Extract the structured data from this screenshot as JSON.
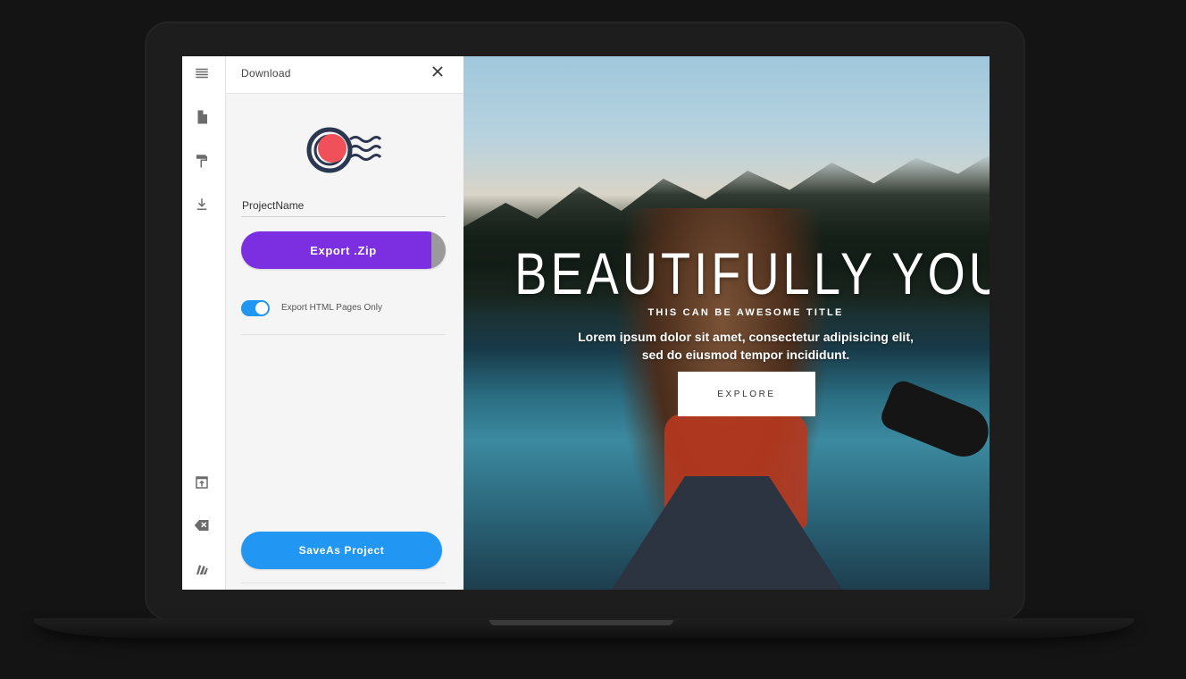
{
  "sidebar": {
    "icons": [
      "menu-icon",
      "page-icon",
      "paint-roller-icon",
      "download-icon",
      "open-external-icon",
      "backspace-icon",
      "layers-icon"
    ]
  },
  "panel": {
    "title": "Download",
    "project_name_value": "ProjectName",
    "export_button_label": "Export .Zip",
    "toggle_label": "Export HTML Pages Only",
    "toggle_on": true,
    "saveas_button_label": "SaveAs Project"
  },
  "preview": {
    "title": "BEAUTIFULLY YOU.",
    "subtitle": "THIS CAN BE AWESOME TITLE",
    "text_line1": "Lorem ipsum dolor sit amet, consectetur adipisicing elit,",
    "text_line2": "sed do eiusmod tempor incididunt.",
    "button_label": "EXPLORE"
  },
  "colors": {
    "export_button": "#7b2fe0",
    "saveas_button": "#2196f3",
    "toggle": "#2196f3",
    "logo_coral": "#f0505a",
    "logo_navy": "#2b3650"
  }
}
